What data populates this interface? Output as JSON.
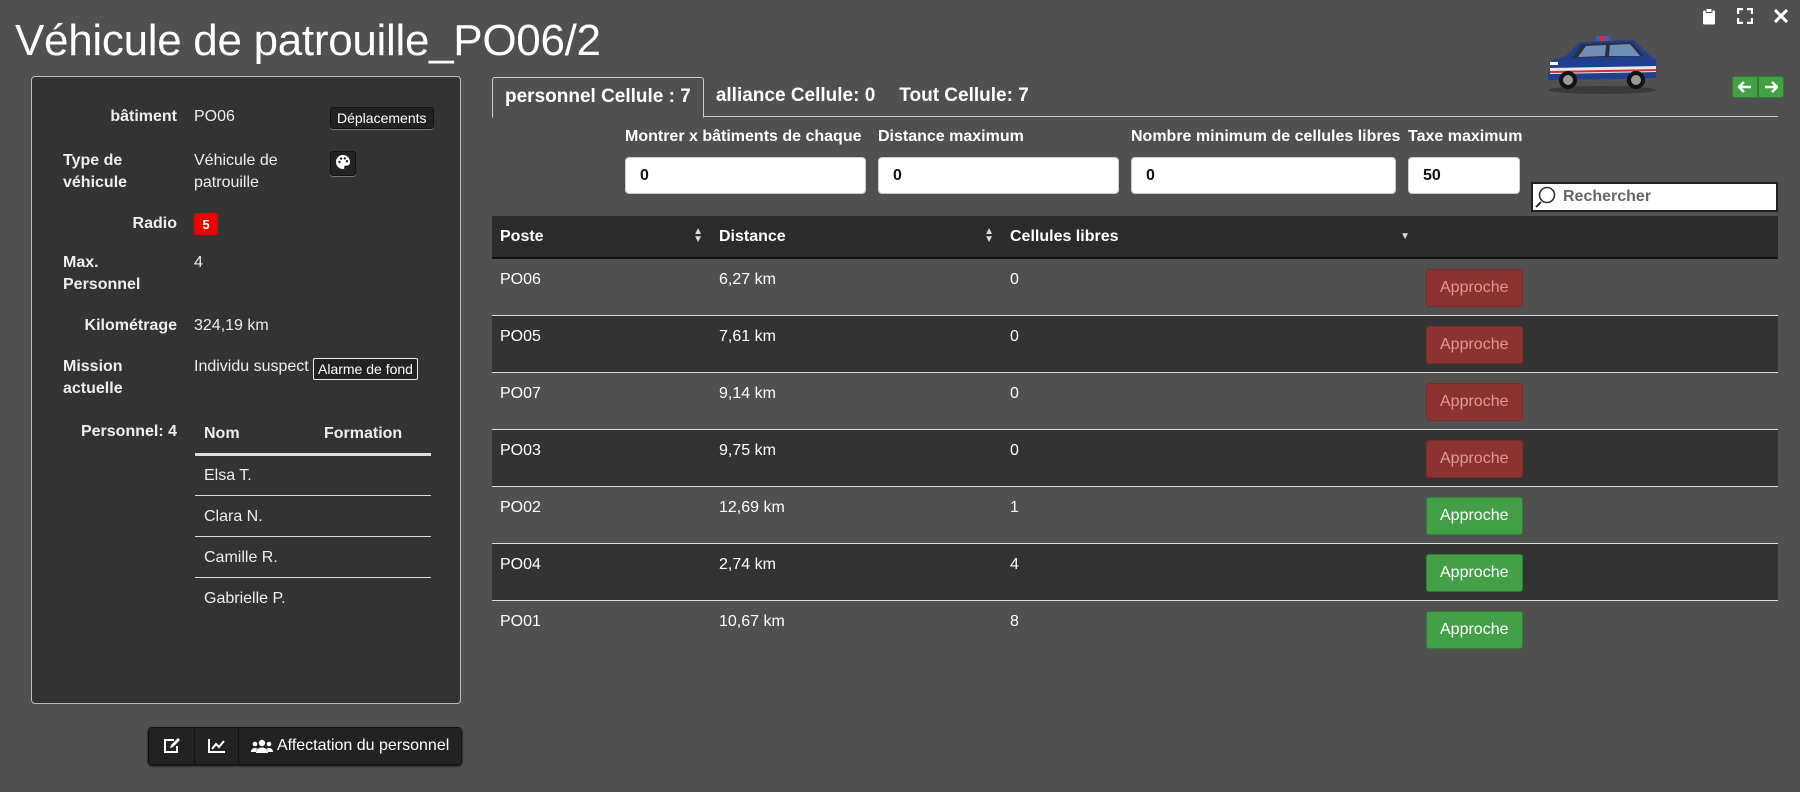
{
  "window": {
    "title": "Véhicule de patrouille_PO06/2"
  },
  "top_icons": [
    "clipboard-icon",
    "fullscreen-icon",
    "close-icon"
  ],
  "vehicle": {
    "batiment_label": "bâtiment",
    "batiment_value": "PO06",
    "deplacements_label": "Déplacements",
    "type_label": "Type de véhicule",
    "type_value": "Véhicule de patrouille",
    "radio_label": "Radio",
    "radio_value": "5",
    "max_label": "Max. Personnel",
    "max_value": "4",
    "km_label": "Kilométrage",
    "km_value": "324,19 km",
    "mission_label": "Mission actuelle",
    "mission_value": "Individu suspect",
    "alarm_label": "Alarme de fond",
    "personnel_label": "Personnel: 4",
    "crew_headers": [
      "Nom",
      "Formation"
    ],
    "crew": [
      {
        "name": "Elsa T.",
        "formation": ""
      },
      {
        "name": "Clara N.",
        "formation": ""
      },
      {
        "name": "Camille R.",
        "formation": ""
      },
      {
        "name": "Gabrielle P.",
        "formation": ""
      }
    ]
  },
  "toolbar": {
    "assign_label": "Affectation du personnel"
  },
  "tabs": [
    {
      "label": "personnel Cellule : 7",
      "active": true
    },
    {
      "label": "alliance Cellule: 0",
      "active": false
    },
    {
      "label": "Tout Cellule: 7",
      "active": false
    }
  ],
  "filters": [
    {
      "label": "Montrer x bâtiments de chaque",
      "value": "0"
    },
    {
      "label": "Distance maximum",
      "value": "0"
    },
    {
      "label": "Nombre minimum de cellules libres",
      "value": "0"
    },
    {
      "label": "Taxe maximum",
      "value": "50"
    }
  ],
  "search": {
    "placeholder": "Rechercher"
  },
  "table": {
    "headers": [
      "Poste",
      "Distance",
      "Cellules libres",
      ""
    ],
    "rows": [
      {
        "poste": "PO06",
        "distance": "6,27 km",
        "cellules": "0",
        "action": "Approche",
        "enabled": false
      },
      {
        "poste": "PO05",
        "distance": "7,61 km",
        "cellules": "0",
        "action": "Approche",
        "enabled": false
      },
      {
        "poste": "PO07",
        "distance": "9,14 km",
        "cellules": "0",
        "action": "Approche",
        "enabled": false
      },
      {
        "poste": "PO03",
        "distance": "9,75 km",
        "cellules": "0",
        "action": "Approche",
        "enabled": false
      },
      {
        "poste": "PO02",
        "distance": "12,69 km",
        "cellules": "1",
        "action": "Approche",
        "enabled": true
      },
      {
        "poste": "PO04",
        "distance": "2,74 km",
        "cellules": "4",
        "action": "Approche",
        "enabled": true
      },
      {
        "poste": "PO01",
        "distance": "10,67 km",
        "cellules": "8",
        "action": "Approche",
        "enabled": true
      }
    ]
  },
  "colors": {
    "background": "#505050",
    "panel": "#333333",
    "approach_disabled": "#8b3330",
    "approach_enabled": "#43a047",
    "radio_badge": "#e00000"
  }
}
